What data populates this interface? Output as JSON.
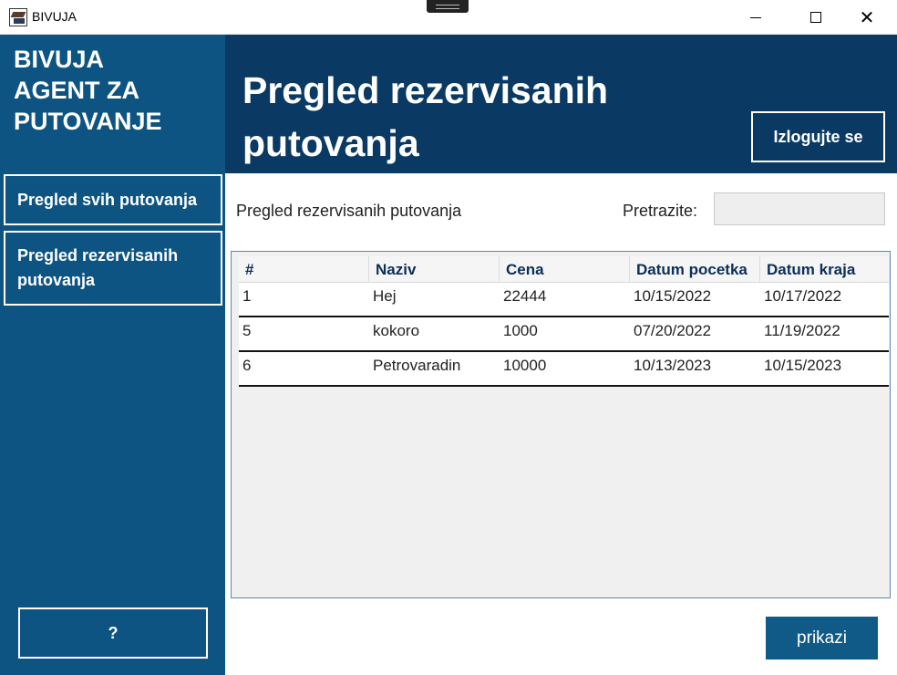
{
  "window": {
    "title": "BIVUJA",
    "icon": "app-logo-icon"
  },
  "sidebar": {
    "brand": "BIVUJA\nAGENT ZA\nPUTOVANJE",
    "items": [
      {
        "label": "Pregled svih putovanja"
      },
      {
        "label": "Pregled rezervisanih putovanja"
      }
    ],
    "help_label": "?"
  },
  "header": {
    "title": "Pregled rezervisanih putovanja",
    "logout_label": "Izlogujte se"
  },
  "main": {
    "section_label": "Pregled rezervisanih putovanja",
    "search_label": "Pretrazite:",
    "search_value": "",
    "show_label": "prikazi"
  },
  "table": {
    "columns": [
      "#",
      "Naziv",
      "Cena",
      "Datum pocetka",
      "Datum kraja"
    ],
    "rows": [
      [
        "1",
        "Hej",
        "22444",
        "10/15/2022",
        "10/17/2022"
      ],
      [
        "5",
        "kokoro",
        "1000",
        "07/20/2022",
        "11/19/2022"
      ],
      [
        "6",
        "Petrovaradin",
        "10000",
        "10/13/2023",
        "10/15/2023"
      ]
    ]
  },
  "colors": {
    "sidebar_bg": "#0e5482",
    "header_bg": "#0a3a63",
    "accent": "#0f5a86",
    "column_header_text": "#0b2f57"
  }
}
